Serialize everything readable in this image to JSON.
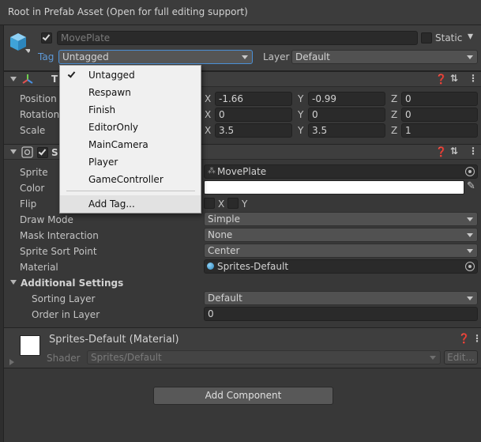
{
  "window": {
    "breadcrumb": "Root in Prefab Asset (Open for full editing support)"
  },
  "gameobject": {
    "name": "MovePlate",
    "static_label": "Static",
    "tag_label": "Tag",
    "tag_value": "Untagged",
    "layer_label": "Layer",
    "layer_value": "Default"
  },
  "transform": {
    "title": "T",
    "position_label": "Position",
    "rotation_label": "Rotation",
    "scale_label": "Scale",
    "position": {
      "x": "-1.66",
      "y": "-0.99",
      "z": "0"
    },
    "rotation": {
      "x": "0",
      "y": "0",
      "z": "0"
    },
    "scale": {
      "x": "3.5",
      "y": "3.5",
      "z": "1"
    },
    "axis_x": "X",
    "axis_y": "Y",
    "axis_z": "Z"
  },
  "sprite_renderer": {
    "title": "S",
    "sprite_label": "Sprite",
    "sprite_value": "MovePlate",
    "color_label": "Color",
    "color_value": "#ffffff",
    "flip_label": "Flip",
    "flip_x": "X",
    "flip_y": "Y",
    "draw_mode_label": "Draw Mode",
    "draw_mode_value": "Simple",
    "mask_label": "Mask Interaction",
    "mask_value": "None",
    "sort_point_label": "Sprite Sort Point",
    "sort_point_value": "Center",
    "material_label": "Material",
    "material_value": "Sprites-Default",
    "additional_settings": "Additional Settings",
    "sorting_layer_label": "Sorting Layer",
    "sorting_layer_value": "Default",
    "order_label": "Order in Layer",
    "order_value": "0"
  },
  "material_section": {
    "name": "Sprites-Default (Material)",
    "shader_label": "Shader",
    "shader_value": "Sprites/Default",
    "edit_label": "Edit..."
  },
  "add_component": "Add Component",
  "tag_menu": {
    "items": [
      "Untagged",
      "Respawn",
      "Finish",
      "EditorOnly",
      "MainCamera",
      "Player",
      "GameController"
    ],
    "selected": "Untagged",
    "add_tag": "Add Tag..."
  },
  "icons": {
    "help": "help-icon",
    "presets": "presets-icon",
    "menu": "kebab-menu-icon"
  }
}
